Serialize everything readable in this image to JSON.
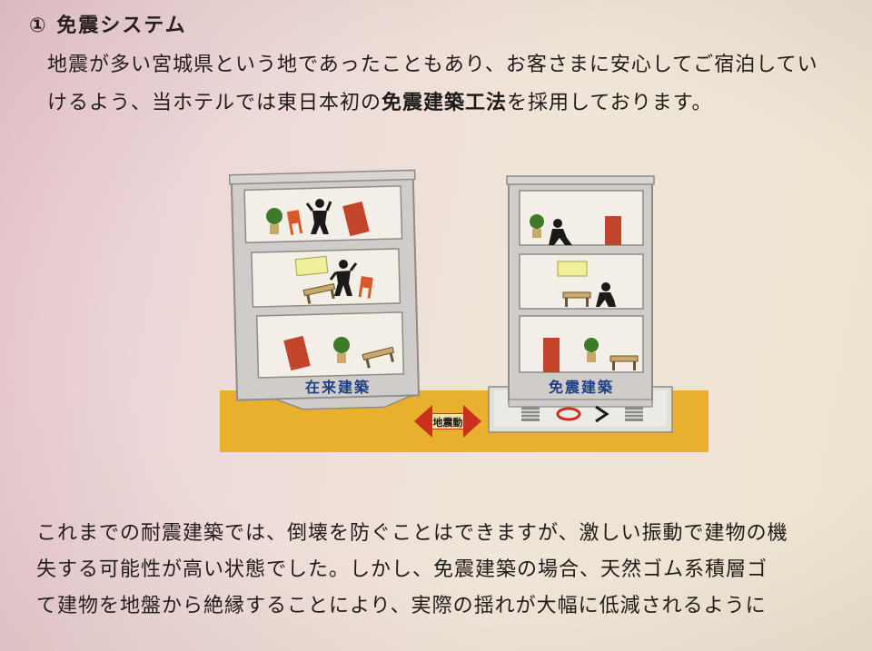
{
  "heading": "① 免震システム",
  "intro": {
    "line1": "地震が多い宮城県という地であったこともあり、お客さまに安心してご宿泊してい",
    "line2_a": "けるよう、当ホテルでは東日本初の",
    "line2_b": "免震建築工法",
    "line2_c": "を採用しております。"
  },
  "figure": {
    "left_label": "在来建築",
    "right_label": "免震建築",
    "arrow_label": "地震動",
    "colors": {
      "ground": "#e8b02c",
      "building_frame": "#cfccca",
      "building_inner": "#f2efe7",
      "label_blue": "#1c3f86",
      "arrow_red": "#c9301e",
      "furniture_red": "#c1442b",
      "chair_orange": "#d9572a",
      "plant_green": "#3d7a2a",
      "picture_yellow": "#eef09a",
      "desk_tan": "#c9a86a"
    }
  },
  "body": {
    "line1": "これまでの耐震建築では、倒壊を防ぐことはできますが、激しい振動で建物の機",
    "line2": "失する可能性が高い状態でした。しかし、免震建築の場合、天然ゴム系積層ゴ",
    "line3": "て建物を地盤から絶縁することにより、実際の揺れが大幅に低減されるように"
  }
}
